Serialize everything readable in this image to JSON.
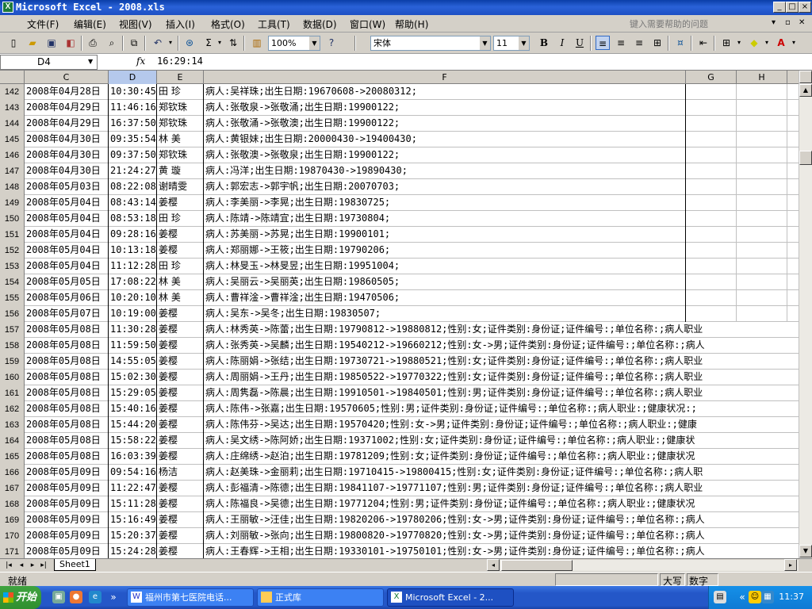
{
  "window": {
    "icon_label": "X",
    "title": "Microsoft Excel - 2008.xls",
    "controls": [
      "_",
      "□",
      "×"
    ]
  },
  "menu": {
    "items": [
      "文件(F)",
      "编辑(E)",
      "视图(V)",
      "插入(I)",
      "格式(O)",
      "工具(T)",
      "数据(D)",
      "窗口(W)",
      "帮助(H)"
    ],
    "help_placeholder": "键入需要帮助的问题"
  },
  "toolbar": {
    "zoom": "100%",
    "font_name": "宋体",
    "font_size": "11",
    "bold": "B",
    "italic": "I",
    "underline": "U"
  },
  "formula": {
    "cell_ref": "D4",
    "fx": "fx",
    "value": "16:29:14"
  },
  "columns": [
    {
      "id": "C",
      "selected": false
    },
    {
      "id": "D",
      "selected": true
    },
    {
      "id": "E",
      "selected": false
    },
    {
      "id": "F",
      "selected": false
    },
    {
      "id": "G",
      "selected": false
    },
    {
      "id": "H",
      "selected": false
    }
  ],
  "rows": [
    {
      "num": "142",
      "date": "2008年04月28日",
      "time": "10:30:45",
      "name": "田 珍",
      "detail": "病人:吴祥珠;出生日期:19670608->20080312;"
    },
    {
      "num": "143",
      "date": "2008年04月29日",
      "time": "11:46:16",
      "name": "郑钦珠",
      "detail": "病人:张敬泉->张敬涌;出生日期:19900122;"
    },
    {
      "num": "144",
      "date": "2008年04月29日",
      "time": "16:37:50",
      "name": "郑钦珠",
      "detail": "病人:张敬涌->张敬澳;出生日期:19900122;"
    },
    {
      "num": "145",
      "date": "2008年04月30日",
      "time": "09:35:54",
      "name": "林 美",
      "detail": "病人:黄银妹;出生日期:20000430->19400430;"
    },
    {
      "num": "146",
      "date": "2008年04月30日",
      "time": "09:37:50",
      "name": "郑钦珠",
      "detail": "病人:张敬澳->张敬泉;出生日期:19900122;"
    },
    {
      "num": "147",
      "date": "2008年04月30日",
      "time": "21:24:27",
      "name": "黄 璇",
      "detail": "病人:冯洋;出生日期:19870430->19890430;"
    },
    {
      "num": "148",
      "date": "2008年05月03日",
      "time": "08:22:08",
      "name": "谢晴雯",
      "detail": "病人:郭宏志->郭宇帆;出生日期:20070703;"
    },
    {
      "num": "149",
      "date": "2008年05月04日",
      "time": "08:43:14",
      "name": "姜樱",
      "detail": "病人:李美丽->李晃;出生日期:19830725;"
    },
    {
      "num": "150",
      "date": "2008年05月04日",
      "time": "08:53:18",
      "name": "田 珍",
      "detail": "病人:陈靖->陈靖宜;出生日期:19730804;"
    },
    {
      "num": "151",
      "date": "2008年05月04日",
      "time": "09:28:16",
      "name": "姜樱",
      "detail": "病人:苏美丽->苏晃;出生日期:19900101;"
    },
    {
      "num": "152",
      "date": "2008年05月04日",
      "time": "10:13:18",
      "name": "姜樱",
      "detail": "病人:郑丽娜->王筱;出生日期:19790206;"
    },
    {
      "num": "153",
      "date": "2008年05月04日",
      "time": "11:12:28",
      "name": "田 珍",
      "detail": "病人:林旻玉->林旻昱;出生日期:19951004;"
    },
    {
      "num": "154",
      "date": "2008年05月05日",
      "time": "17:08:22",
      "name": "林 美",
      "detail": "病人:吴丽云->吴丽英;出生日期:19860505;"
    },
    {
      "num": "155",
      "date": "2008年05月06日",
      "time": "10:20:10",
      "name": "林 美",
      "detail": "病人:曹祥淦->曹祥淦;出生日期:19470506;"
    },
    {
      "num": "156",
      "date": "2008年05月07日",
      "time": "10:19:00",
      "name": "姜樱",
      "detail": "病人:吴东->吴冬;出生日期:19830507;"
    },
    {
      "num": "157",
      "date": "2008年05月08日",
      "time": "11:30:28",
      "name": "姜樱",
      "detail": "病人:林秀英->陈蕾;出生日期:19790812->19880812;性别:女;证件类别:身份证;证件编号:;单位名称:;病人职业"
    },
    {
      "num": "158",
      "date": "2008年05月08日",
      "time": "11:59:50",
      "name": "姜樱",
      "detail": "病人:张秀英->吴麟;出生日期:19540212->19660212;性别:女->男;证件类别:身份证;证件编号:;单位名称:;病人"
    },
    {
      "num": "159",
      "date": "2008年05月08日",
      "time": "14:55:05",
      "name": "姜樱",
      "detail": "病人:陈丽娟->张结;出生日期:19730721->19880521;性别:女;证件类别:身份证;证件编号:;单位名称:;病人职业"
    },
    {
      "num": "160",
      "date": "2008年05月08日",
      "time": "15:02:30",
      "name": "姜樱",
      "detail": "病人:周丽娟->王丹;出生日期:19850522->19770322;性别:女;证件类别:身份证;证件编号:;单位名称:;病人职业"
    },
    {
      "num": "161",
      "date": "2008年05月08日",
      "time": "15:29:05",
      "name": "姜樱",
      "detail": "病人:周隽磊->陈晨;出生日期:19910501->19840501;性别:男;证件类别:身份证;证件编号:;单位名称:;病人职业"
    },
    {
      "num": "162",
      "date": "2008年05月08日",
      "time": "15:40:16",
      "name": "姜樱",
      "detail": "病人:陈伟->张嘉;出生日期:19570605;性别:男;证件类别:身份证;证件编号:;单位名称:;病人职业:;健康状况:;"
    },
    {
      "num": "163",
      "date": "2008年05月08日",
      "time": "15:44:20",
      "name": "姜樱",
      "detail": "病人:陈伟芬->吴达;出生日期:19570420;性别:女->男;证件类别:身份证;证件编号:;单位名称:;病人职业:;健康"
    },
    {
      "num": "164",
      "date": "2008年05月08日",
      "time": "15:58:22",
      "name": "姜樱",
      "detail": "病人:吴文绣->陈阿娇;出生日期:19371002;性别:女;证件类别:身份证;证件编号:;单位名称:;病人职业:;健康状"
    },
    {
      "num": "165",
      "date": "2008年05月08日",
      "time": "16:03:39",
      "name": "姜樱",
      "detail": "病人:庄绵绣->赵泊;出生日期:19781209;性别:女;证件类别:身份证;证件编号:;单位名称:;病人职业:;健康状况"
    },
    {
      "num": "166",
      "date": "2008年05月09日",
      "time": "09:54:16",
      "name": "杨洁",
      "detail": "病人:赵美珠->金丽莉;出生日期:19710415->19800415;性别:女;证件类别:身份证;证件编号:;单位名称:;病人职"
    },
    {
      "num": "167",
      "date": "2008年05月09日",
      "time": "11:22:47",
      "name": "姜樱",
      "detail": "病人:彭福清->陈德;出生日期:19841107->19771107;性别:男;证件类别:身份证;证件编号:;单位名称:;病人职业"
    },
    {
      "num": "168",
      "date": "2008年05月09日",
      "time": "15:11:28",
      "name": "姜樱",
      "detail": "病人:陈福良->吴德;出生日期:19771204;性别:男;证件类别:身份证;证件编号:;单位名称:;病人职业:;健康状况"
    },
    {
      "num": "169",
      "date": "2008年05月09日",
      "time": "15:16:49",
      "name": "姜樱",
      "detail": "病人:王丽敏->汪佳;出生日期:19820206->19780206;性别:女->男;证件类别:身份证;证件编号:;单位名称:;病人"
    },
    {
      "num": "170",
      "date": "2008年05月09日",
      "time": "15:20:37",
      "name": "姜樱",
      "detail": "病人:刘丽敏->张向;出生日期:19800820->19770820;性别:女->男;证件类别:身份证;证件编号:;单位名称:;病人"
    },
    {
      "num": "171",
      "date": "2008年05月09日",
      "time": "15:24:28",
      "name": "姜樱",
      "detail": "病人:王春辉->王相;出生日期:19330101->19750101;性别:女->男;证件类别:身份证;证件编号:;单位名称:;病人"
    }
  ],
  "sheet": {
    "tab": "Sheet1"
  },
  "status": {
    "ready": "就绪",
    "caps": "大写",
    "num": "数字"
  },
  "taskbar": {
    "start": "开始",
    "tasks": [
      "福州市第七医院电话...",
      "正式库",
      "Microsoft Excel - 2..."
    ],
    "clock": "11:37"
  },
  "colors": {
    "title_bar": "#1d4fc4",
    "selected_header": "#b5c9ec",
    "taskbar": "#2457c8",
    "start_button": "#3fa33f"
  }
}
